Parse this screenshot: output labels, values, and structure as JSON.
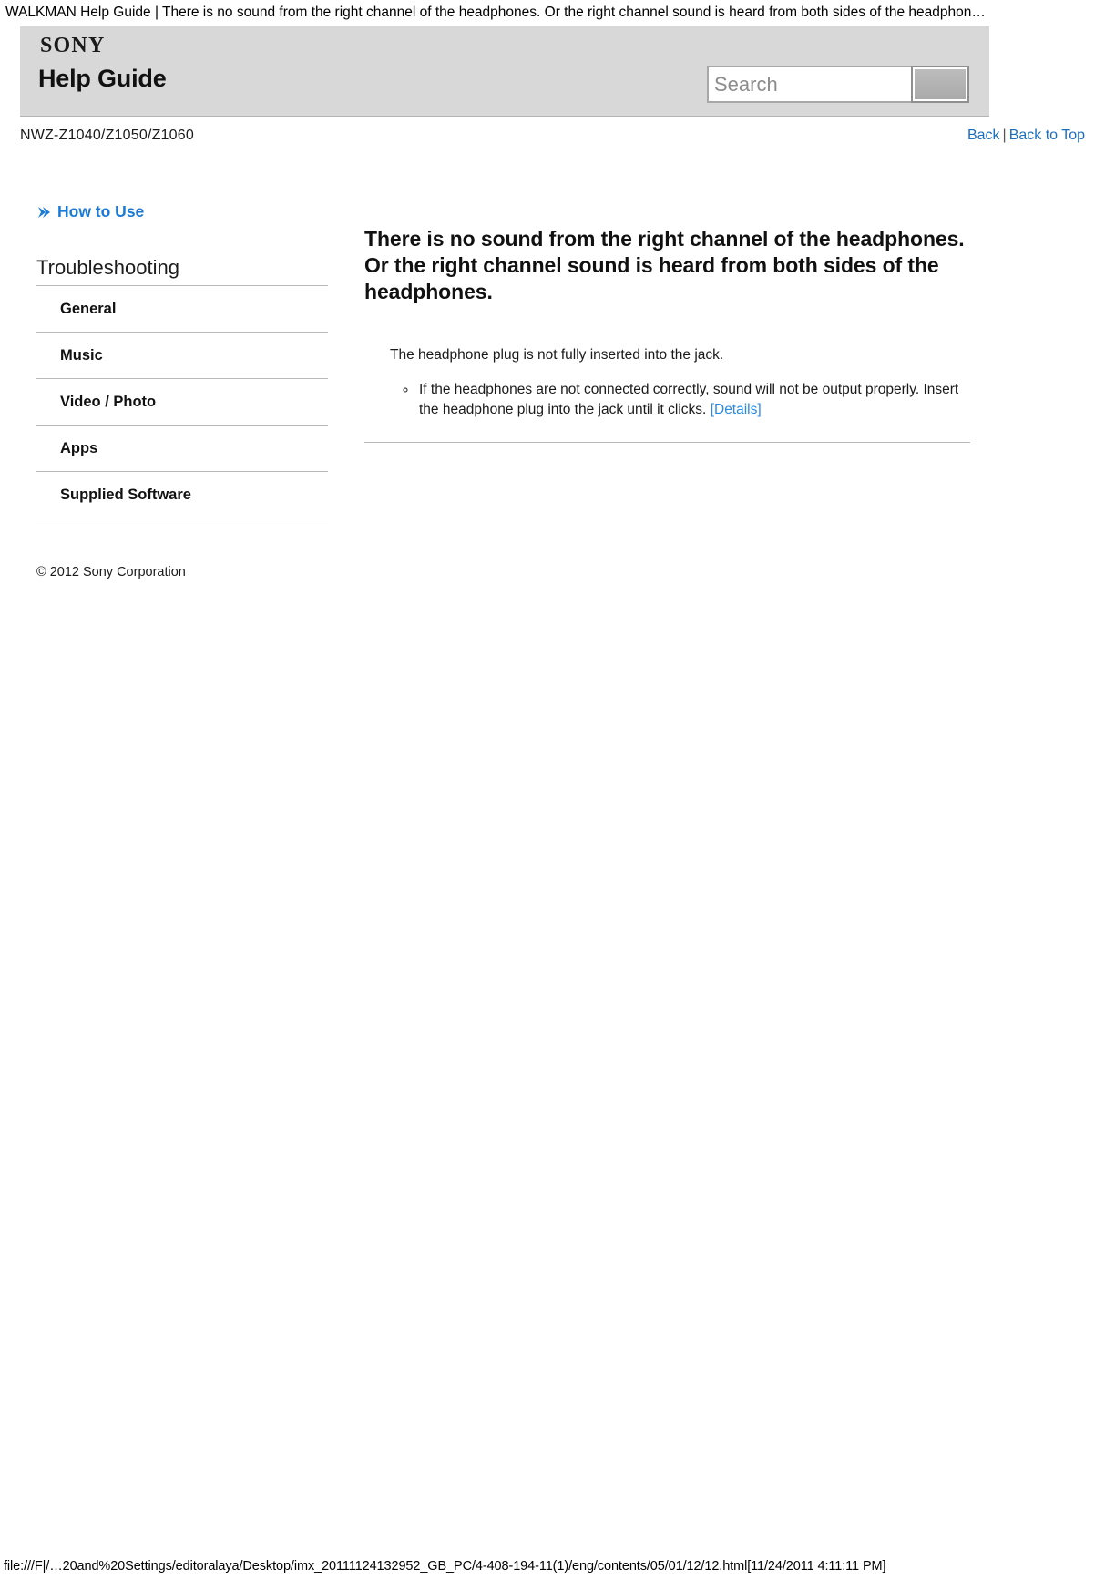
{
  "window": {
    "page_header_title": "WALKMAN Help Guide | There is no sound from the right channel of the headphones. Or the right channel sound is heard from both sides of the headphon…",
    "footer_url": "file:///F|/…20and%20Settings/editoralaya/Desktop/imx_20111124132952_GB_PC/4-408-194-11(1)/eng/contents/05/01/12/12.html[11/24/2011 4:11:11 PM]"
  },
  "banner": {
    "brand": "SONY",
    "title": "Help Guide",
    "background_color": "#d8d8d8"
  },
  "search": {
    "placeholder": "Search",
    "value": "",
    "button_label": ""
  },
  "model_bar": {
    "model": "NWZ-Z1040/Z1050/Z1060",
    "back_label": "Back",
    "separator": "|",
    "back_to_top_label": "Back to Top",
    "link_color": "#1a6ec0"
  },
  "sidebar": {
    "how_to_use": {
      "label": "How to Use",
      "icon": "chevron-right-icon",
      "color": "#1a7ad4"
    },
    "section_title": "Troubleshooting",
    "items": [
      {
        "label": "General"
      },
      {
        "label": "Music"
      },
      {
        "label": "Video / Photo"
      },
      {
        "label": "Apps"
      },
      {
        "label": "Supplied Software"
      }
    ],
    "copyright": "© 2012 Sony Corporation"
  },
  "main": {
    "heading": "There is no sound from the right channel of the headphones. Or the right channel sound is heard from both sides of the headphones.",
    "cause": "The headphone plug is not fully inserted into the jack.",
    "remedy_text": "If the headphones are not connected correctly, sound will not be output properly. Insert the headphone plug into the jack until it clicks.",
    "details_link": "[Details]",
    "details_link_color": "#2a8ae0"
  }
}
